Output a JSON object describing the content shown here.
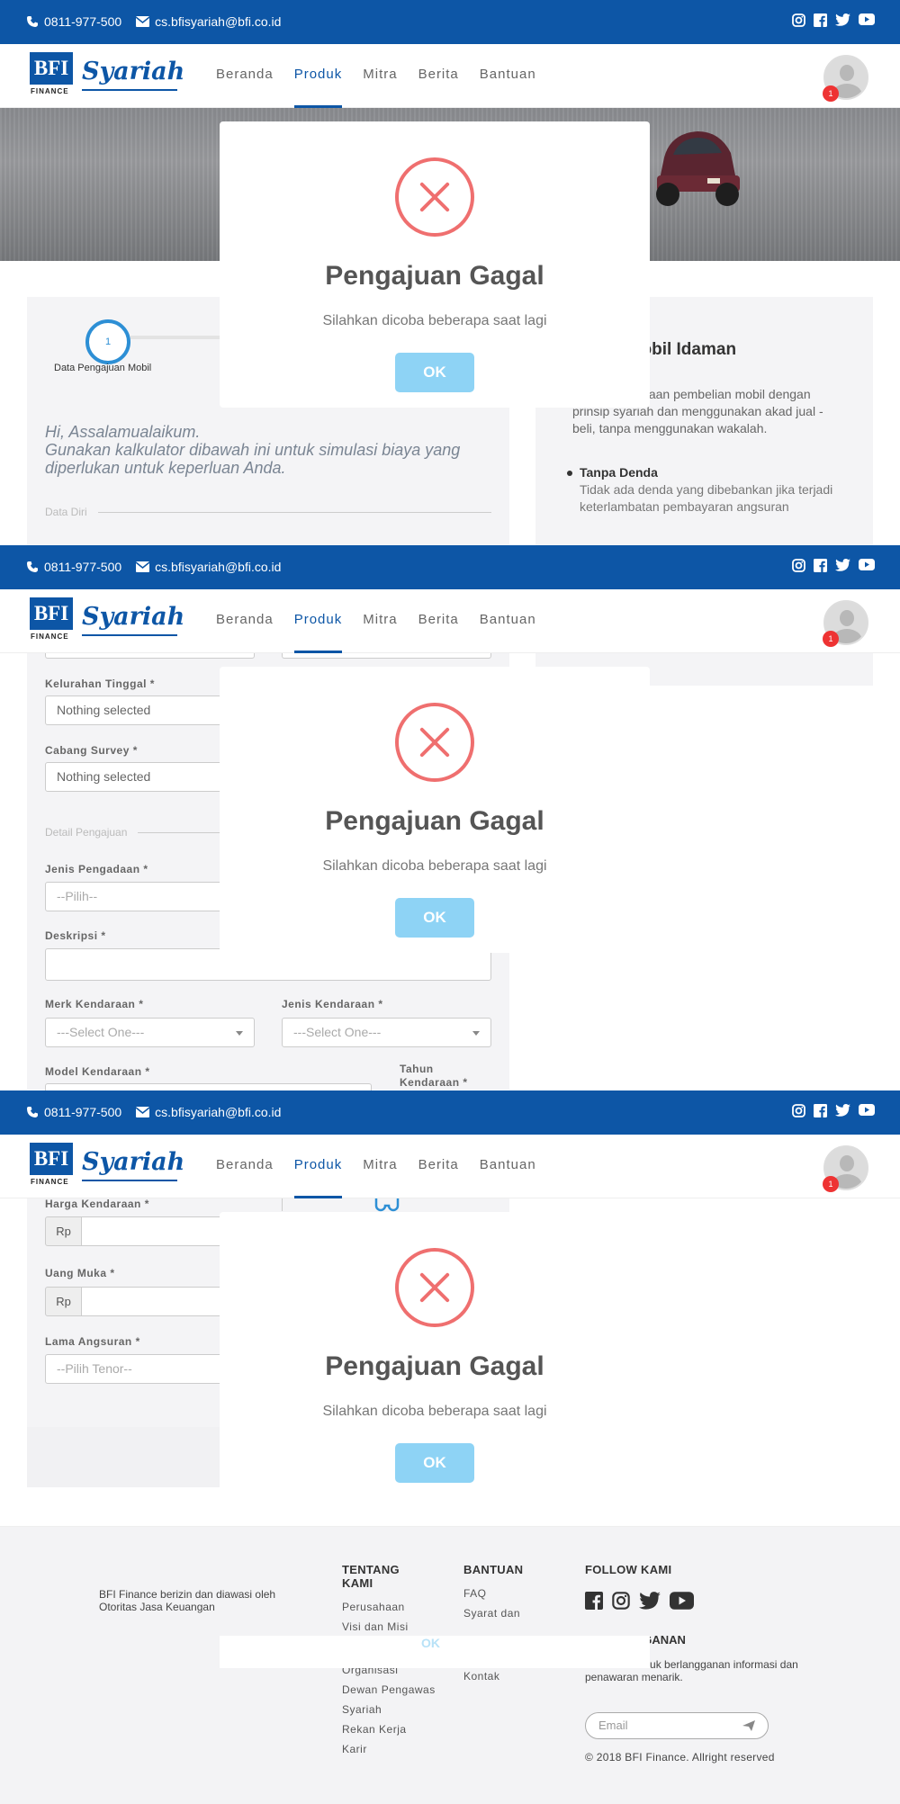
{
  "contact": {
    "phone": "0811-977-500",
    "email": "cs.bfisyariah@bfi.co.id"
  },
  "brand": {
    "bfi": "BFI",
    "finance": "FINANCE",
    "syariah": "Syariah"
  },
  "nav": {
    "items": [
      "Beranda",
      "Produk",
      "Mitra",
      "Berita",
      "Bantuan"
    ],
    "active": "Produk",
    "notification_count": "1"
  },
  "social_icons": [
    "instagram-icon",
    "facebook-icon",
    "twitter-icon",
    "youtube-icon"
  ],
  "stepper": {
    "step_number": "1",
    "step_label": "Data Pengajuan Mobil"
  },
  "form": {
    "greeting_line1": "Hi, Assalamualaikum.",
    "greeting_line2": "Gunakan kalkulator dibawah ini untuk simulasi biaya yang diperlukan untuk keperluan Anda.",
    "section_data_diri": "Data Diri",
    "kelurahan_label": "Kelurahan Tinggal *",
    "kelurahan_value": "Nothing selected",
    "cabang_label": "Cabang Survey *",
    "cabang_value": "Nothing selected",
    "section_detail": "Detail Pengajuan",
    "jenis_pengadaan_label": "Jenis Pengadaan *",
    "jenis_pengadaan_placeholder": "--Pilih--",
    "deskripsi_label": "Deskripsi *",
    "merk_label": "Merk Kendaraan *",
    "merk_placeholder": "---Select One---",
    "jenis_kendaraan_label": "Jenis Kendaraan *",
    "jenis_kendaraan_placeholder": "---Select One---",
    "model_label": "Model Kendaraan *",
    "tahun_label": "Tahun Kendaraan *",
    "harga_label": "Harga Kendaraan *",
    "uang_muka_label": "Uang Muka *",
    "currency": "Rp",
    "lama_label": "Lama Angsuran *",
    "lama_placeholder": "--Pilih Tenor--"
  },
  "product_info": {
    "title": "Segera Mobil Idaman",
    "desc": "alah Pembiayaan pembelian mobil dengan prinsip syariah dan menggunakan akad jual - beli, tanpa menggunakan wakalah.",
    "benefit_title": "Tanpa Denda",
    "benefit_text": "Tidak ada denda yang dibebankan jika terjadi keterlambatan pembayaran angsuran"
  },
  "modal": {
    "title": "Pengajuan Gagal",
    "message": "Silahkan dicoba beberapa saat lagi",
    "ok_label": "OK"
  },
  "footer": {
    "about": "BFI Finance berizin dan diawasi oleh Otoritas Jasa Keuangan",
    "tentang_title": "TENTANG KAMI",
    "tentang_links": [
      "Perusahaan",
      "Visi dan Misi",
      "Organisasi",
      "Dewan Pengawas Syariah",
      "Rekan Kerja",
      "Karir"
    ],
    "bantuan_title": "BANTUAN",
    "bantuan_links": [
      "FAQ",
      "Syarat dan",
      "Kontak"
    ],
    "follow_title": "FOLLOW KAMI",
    "subscribe_title": "BERLANGGANAN",
    "subscribe_text": "mail anda untuk berlangganan informasi dan penawaran menarik.",
    "email_placeholder": "Email",
    "copyright": "© 2018 BFI Finance. Allright reserved"
  }
}
